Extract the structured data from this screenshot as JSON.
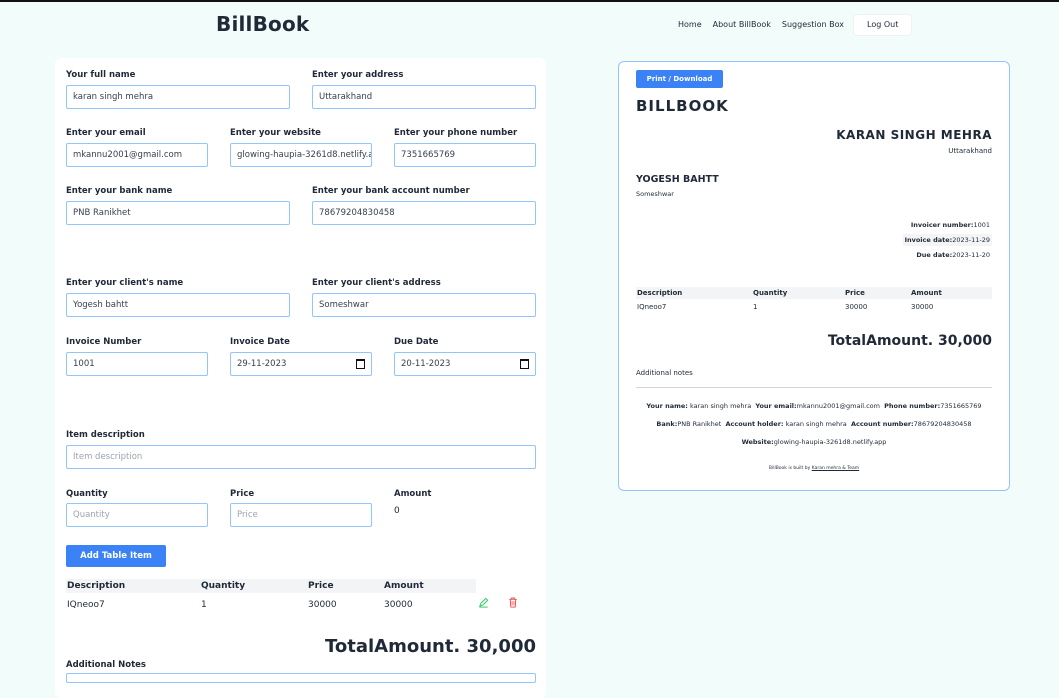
{
  "header": {
    "brand": "BillBook",
    "nav": [
      "Home",
      "About BillBook",
      "Suggestion Box"
    ],
    "logout": "Log Out"
  },
  "form": {
    "full_name": {
      "label": "Your full name",
      "value": "karan singh mehra"
    },
    "address": {
      "label": "Enter your address",
      "value": "Uttarakhand"
    },
    "email": {
      "label": "Enter your email",
      "value": "mkannu2001@gmail.com"
    },
    "website": {
      "label": "Enter your website",
      "value": "glowing-haupia-3261d8.netlify.a"
    },
    "phone": {
      "label": "Enter your phone number",
      "value": "7351665769"
    },
    "bank_name": {
      "label": "Enter your bank name",
      "value": "PNB Ranikhet"
    },
    "bank_account": {
      "label": "Enter your bank account number",
      "value": "78679204830458"
    },
    "client_name": {
      "label": "Enter your client's name",
      "value": "Yogesh bahtt"
    },
    "client_address": {
      "label": "Enter your client's address",
      "value": "Someshwar"
    },
    "invoice_number": {
      "label": "Invoice Number",
      "value": "1001"
    },
    "invoice_date": {
      "label": "Invoice Date",
      "value": "29-11-2023"
    },
    "due_date": {
      "label": "Due Date",
      "value": "20-11-2023"
    },
    "item_description": {
      "label": "Item description",
      "placeholder": "Item description"
    },
    "quantity": {
      "label": "Quantity",
      "placeholder": "Quantity"
    },
    "price": {
      "label": "Price",
      "placeholder": "Price"
    },
    "amount": {
      "label": "Amount",
      "value": "0"
    },
    "add_button": "Add Table Item",
    "table": {
      "headers": [
        "Description",
        "Quantity",
        "Price",
        "Amount"
      ],
      "rows": [
        [
          "IQneoo7",
          "1",
          "30000",
          "30000"
        ]
      ]
    },
    "total": "TotalAmount. 30,000",
    "notes_label": "Additional Notes"
  },
  "preview": {
    "print_button": "Print / Download",
    "title": "BILLBOOK",
    "name": "KARAN SINGH MEHRA",
    "address": "Uttarakhand",
    "client_name": "YOGESH BAHTT",
    "client_address": "Someshwar",
    "meta": [
      {
        "label": "Invoicer number:",
        "value": "1001"
      },
      {
        "label": "Invoice date:",
        "value": "2023-11-29"
      },
      {
        "label": "Due date:",
        "value": "2023-11-20"
      }
    ],
    "table": {
      "headers": [
        "Description",
        "Quantity",
        "Price",
        "Amount"
      ],
      "rows": [
        [
          "IQneoo7",
          "1",
          "30000",
          "30000"
        ]
      ]
    },
    "total": "TotalAmount. 30,000",
    "notes": "Additional notes",
    "footer": {
      "name_label": "Your name:",
      "name": "karan singh mehra",
      "email_label": "Your email:",
      "email": "mkannu2001@gmail.com",
      "phone_label": "Phone number:",
      "phone": "7351665769",
      "bank_label": "Bank:",
      "bank": "PNB Ranikhet",
      "holder_label": "Account holder:",
      "holder": "karan singh mehra",
      "account_label": "Account number:",
      "account": "78679204830458",
      "website_label": "Website:",
      "website": "glowing-haupia-3261d8.netlify.app"
    },
    "credit_text": "BillBook is built by",
    "credit_link": "Karan mehra & Team"
  },
  "colors": {
    "accent": "#3b82f6",
    "background": "#f1fcfb",
    "input_border": "#93c5fd",
    "delete": "#ef4444",
    "edit": "#22c55e"
  }
}
